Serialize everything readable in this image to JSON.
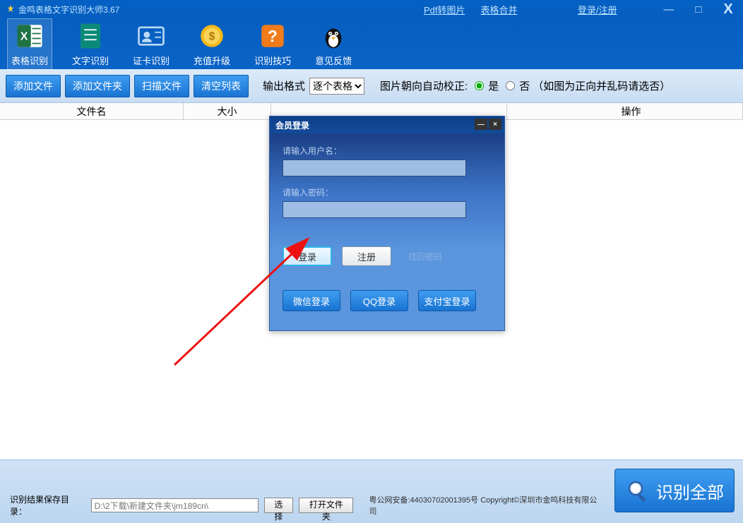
{
  "titlebar": {
    "title": "金鸣表格文字识别大师3.67",
    "link_pdf": "Pdf转图片",
    "link_merge": "表格合并",
    "link_auth": "登录/注册",
    "win_min": "—",
    "win_max": "□",
    "win_close": "X"
  },
  "toolbar": {
    "items": [
      {
        "label": "表格识别"
      },
      {
        "label": "文字识别"
      },
      {
        "label": "证卡识别"
      },
      {
        "label": "充值升级"
      },
      {
        "label": "识别技巧"
      },
      {
        "label": "意见反馈"
      }
    ]
  },
  "secondbar": {
    "btn_add_file": "添加文件",
    "btn_add_folder": "添加文件夹",
    "btn_scan": "扫描文件",
    "btn_clear": "清空列表",
    "output_label": "输出格式",
    "output_options": [
      "逐个表格"
    ],
    "output_selected": "逐个表格",
    "orient_label": "图片朝向自动校正:",
    "orient_yes": "是",
    "orient_no": "否",
    "orient_hint": "（如图为正向并乱码请选否）"
  },
  "columns": {
    "filename": "文件名",
    "size": "大小",
    "oper": "操作"
  },
  "login": {
    "title": "会员登录",
    "username_label": "请输入用户名：",
    "password_label": "请输入密码：",
    "btn_login": "登录",
    "btn_register": "注册",
    "link_forgot": "找回密码",
    "btn_wechat": "微信登录",
    "btn_qq": "QQ登录",
    "btn_alipay": "支付宝登录",
    "min": "—",
    "close": "×"
  },
  "footer": {
    "save_label": "识别结果保存目录：",
    "save_path": "D:\\2下载\\新建文件夹\\jm189cn\\",
    "btn_choose": "选择",
    "btn_open": "打开文件夹",
    "copyright": "粤公网安备:44030702001395号 Copyright©深圳市金鸣科技有限公司",
    "recognize_all": "识别全部"
  }
}
